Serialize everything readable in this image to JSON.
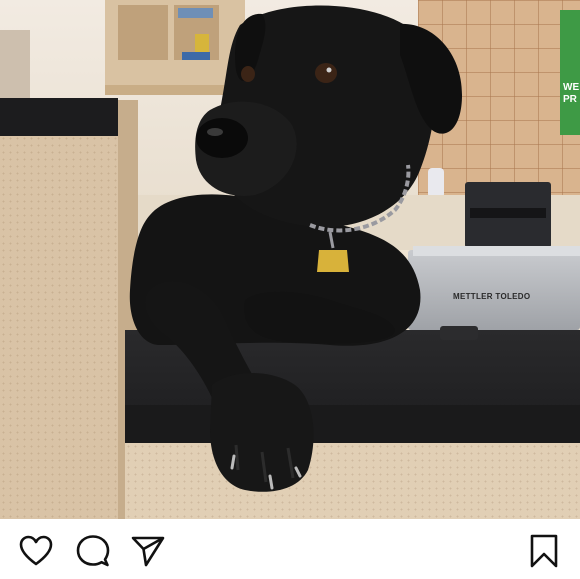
{
  "post": {
    "photo": {
      "scale_brand_text": "METTLER TOLEDO",
      "sign_text": "WE\nPR",
      "dog_color": "#141414",
      "tag_color": "#d8b23a"
    },
    "actions": {
      "like_icon": "heart-icon",
      "comment_icon": "comment-icon",
      "share_icon": "send-icon",
      "save_icon": "bookmark-icon"
    }
  }
}
